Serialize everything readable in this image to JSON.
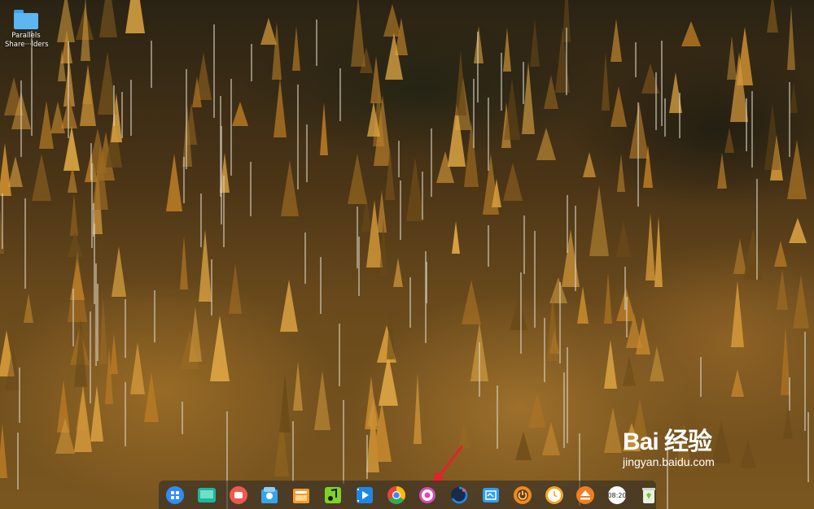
{
  "desktop": {
    "icons": [
      {
        "label_line1": "Parallels",
        "label_line2": "Share···lders",
        "icon": "folder-icon"
      }
    ]
  },
  "dock": {
    "items": [
      {
        "name": "launcher",
        "icon": "launcher-icon",
        "color": "#2f8df5"
      },
      {
        "name": "multitasking-view",
        "icon": "multitask-icon",
        "color": "#1db7a0"
      },
      {
        "name": "screen-recorder",
        "icon": "record-icon",
        "color": "#f0584f"
      },
      {
        "name": "app-store",
        "icon": "store-icon",
        "color": "#33a5ee"
      },
      {
        "name": "file-manager",
        "icon": "files-icon",
        "color": "#f59b2b"
      },
      {
        "name": "music",
        "icon": "music-icon",
        "color": "#7fd12a"
      },
      {
        "name": "movie",
        "icon": "video-icon",
        "color": "#1e86e8"
      },
      {
        "name": "chrome",
        "icon": "chrome-icon",
        "color": "#e94335"
      },
      {
        "name": "control-center",
        "icon": "gear-icon",
        "color": "#d64bb5"
      },
      {
        "name": "deepin-browser",
        "icon": "browser-icon",
        "color": "#1c8cf3"
      },
      {
        "name": "screenshot",
        "icon": "screenshot-icon",
        "color": "#2c9ef0"
      },
      {
        "name": "shutdown",
        "icon": "power-icon",
        "color": "#f08a1f"
      },
      {
        "name": "clock",
        "icon": "clock-icon",
        "color": "#f5a623"
      },
      {
        "name": "eject",
        "icon": "eject-icon",
        "color": "#f57c1f"
      },
      {
        "name": "datetime",
        "icon": "datetime-icon",
        "color": "#ffffff",
        "text": "08:20"
      },
      {
        "name": "trash",
        "icon": "trash-icon",
        "color": "#7fbf3f"
      }
    ]
  },
  "watermark": {
    "logo": "Bai 经验",
    "url": "jingyan.baidu.com"
  }
}
